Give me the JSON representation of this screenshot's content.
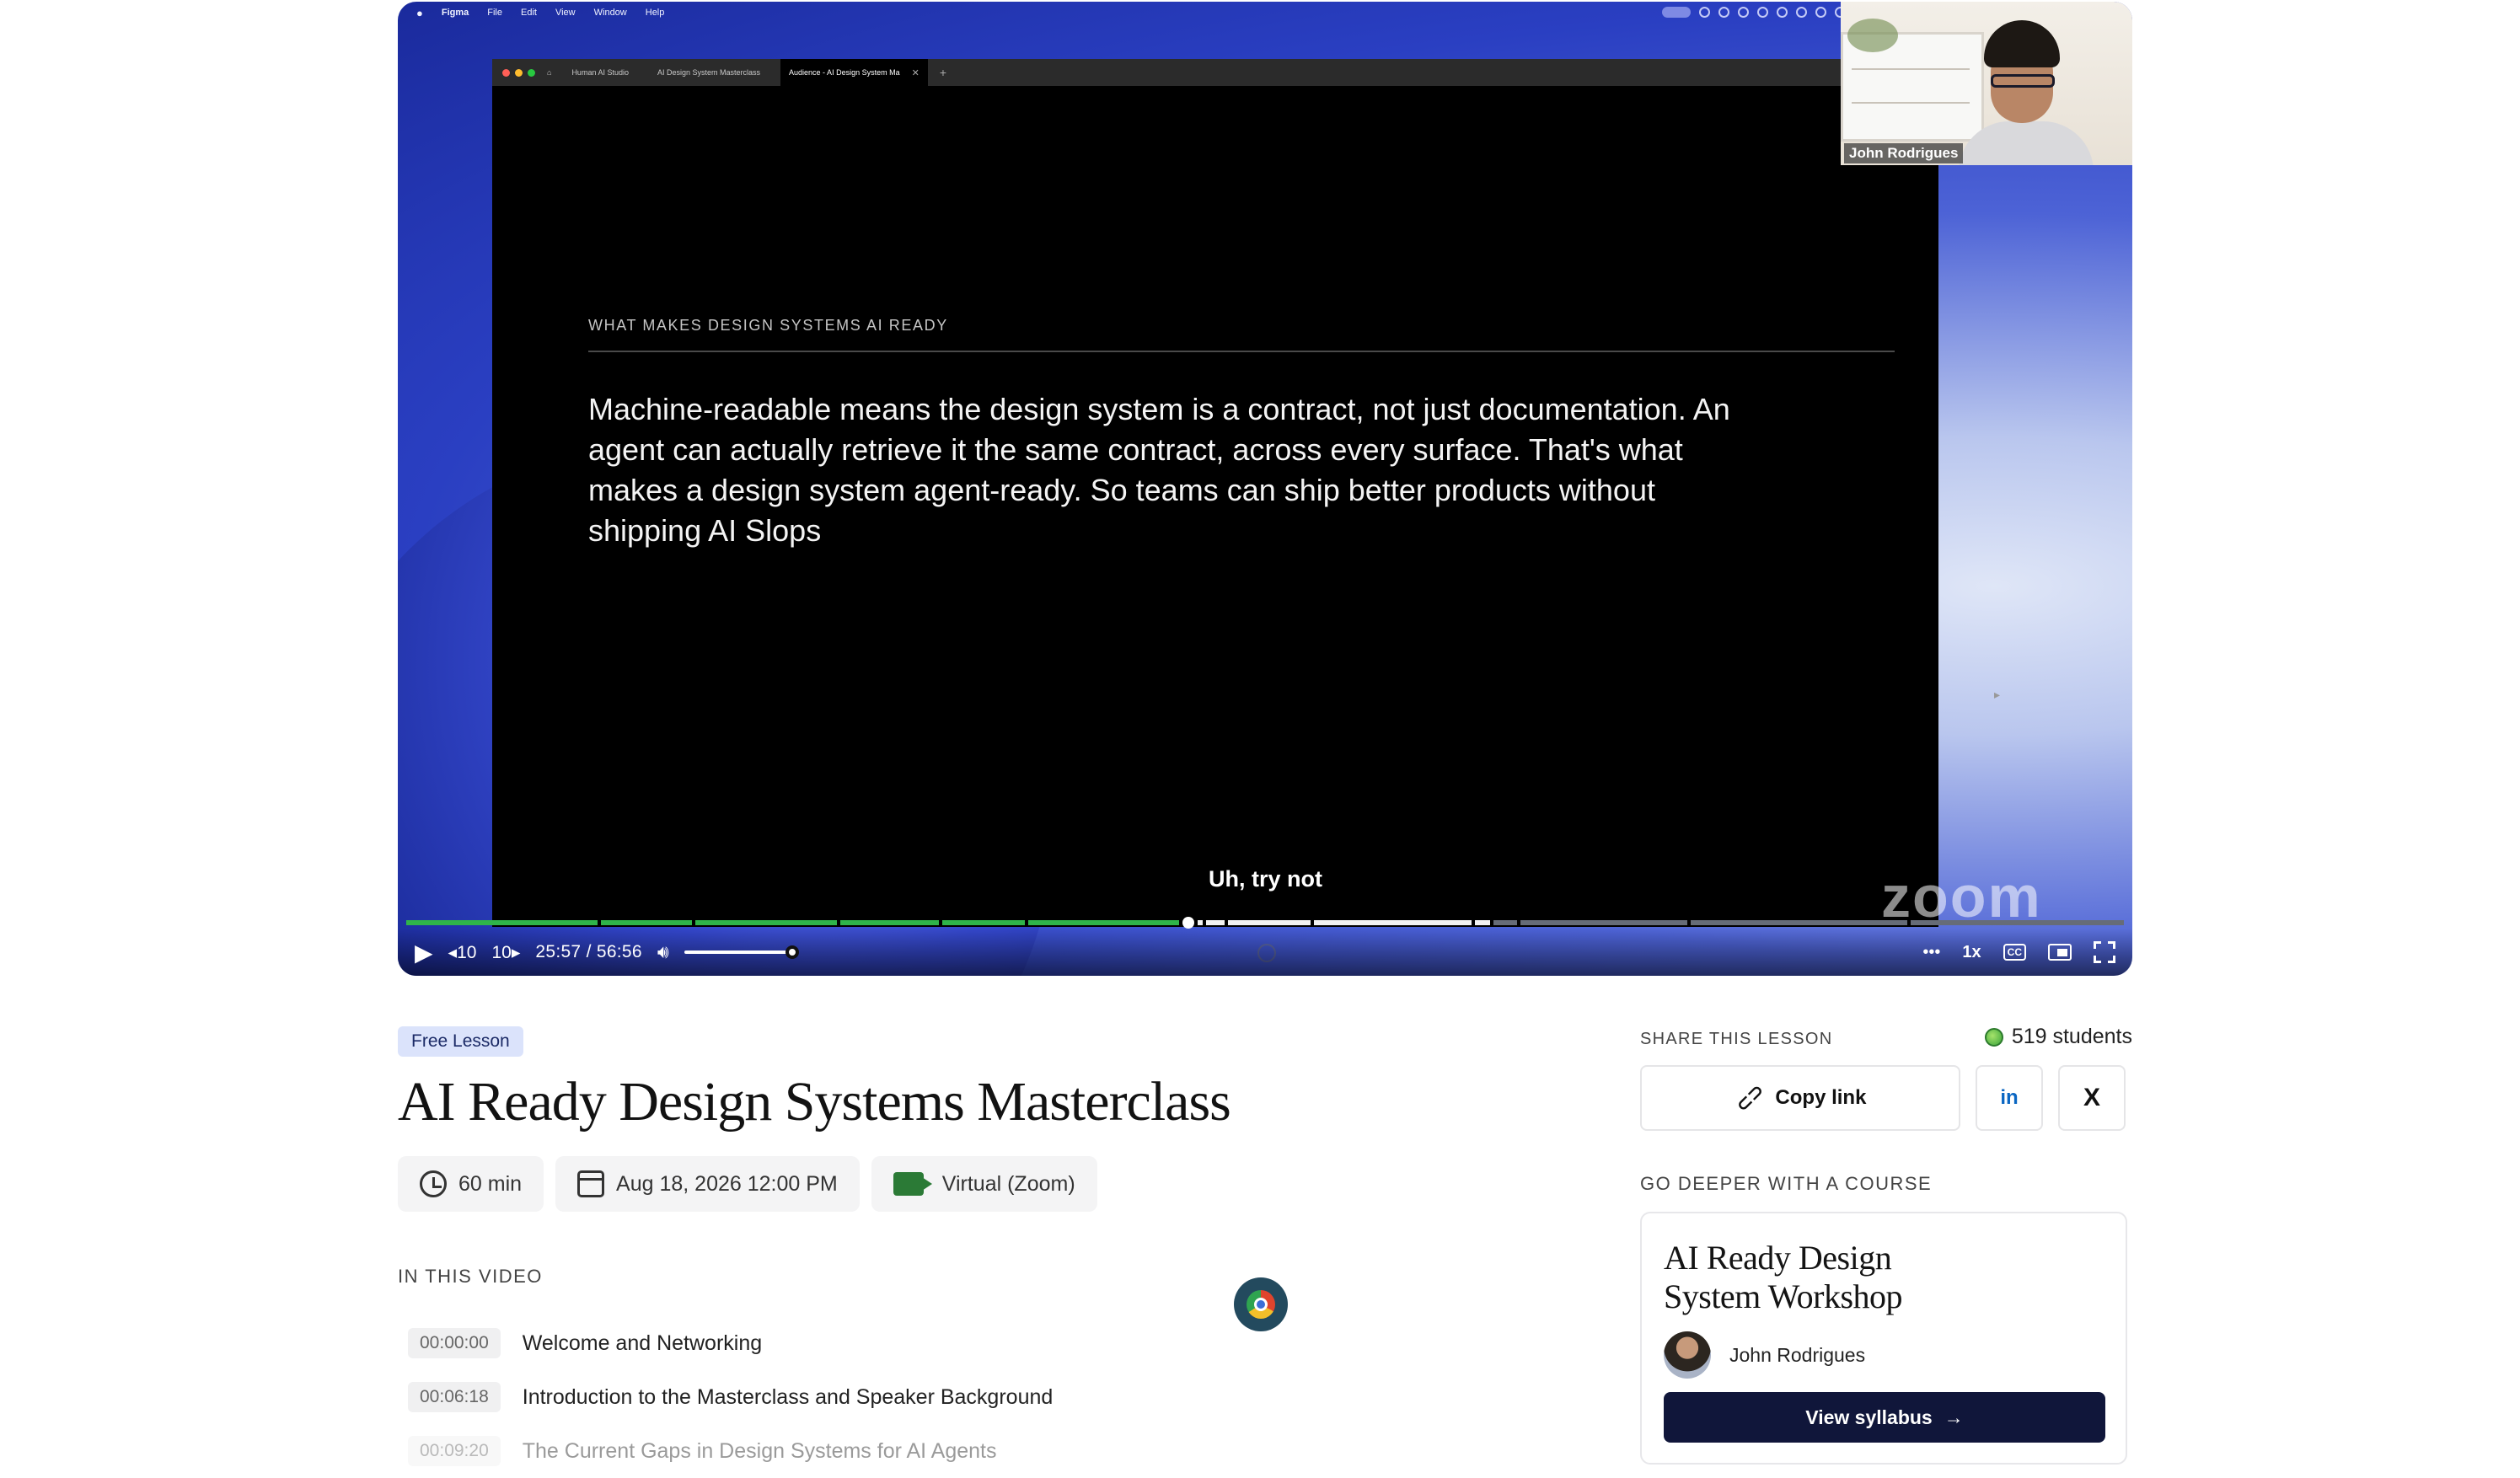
{
  "player": {
    "mac_menu": [
      "Figma",
      "File",
      "Edit",
      "View",
      "Window",
      "Help"
    ],
    "browser_tabs": [
      "Human AI Studio",
      "AI Design System Masterclass",
      "Audience - AI Design System Ma"
    ],
    "slide_kicker": "WHAT MAKES DESIGN SYSTEMS AI READY",
    "slide_body": "Machine-readable means the design system is a contract, not just documentation. An agent can actually retrieve it the same contract, across every surface. That's what makes a design system agent-ready. So teams can ship better products without shipping AI Slops",
    "webcam_name": "John Rodrigues",
    "caption": "Uh, try not",
    "watermark": "zoom",
    "controls": {
      "rewind_label": "10",
      "forward_label": "10",
      "current_time": "25:57",
      "separator": "/",
      "duration": "56:56",
      "speed": "1x",
      "cc_label": "CC",
      "volume_level": 1.0,
      "progress_fraction": 0.456,
      "buffered_fraction": 0.627
    },
    "colors": {
      "progress_played": "#2fb44a",
      "background_blue": "#2a3fc2"
    }
  },
  "lesson": {
    "badge": "Free Lesson",
    "title": "AI Ready Design Systems Masterclass",
    "duration": "60 min",
    "datetime": "Aug 18, 2026 12:00 PM",
    "location": "Virtual (Zoom)",
    "in_this_video_heading": "IN THIS VIDEO",
    "chapters": [
      {
        "time": "00:00:00",
        "title": "Welcome and Networking"
      },
      {
        "time": "00:06:18",
        "title": "Introduction to the Masterclass and Speaker Background"
      },
      {
        "time": "00:09:20",
        "title": "The Current Gaps in Design Systems for AI Agents"
      }
    ]
  },
  "sidebar": {
    "share_heading": "SHARE THIS LESSON",
    "students": "519 students",
    "copy_link": "Copy link",
    "linkedin": "in",
    "x": "X",
    "deeper_heading": "GO DEEPER WITH A COURSE",
    "course": {
      "title": "AI Ready Design System Workshop",
      "instructor": "John Rodrigues",
      "cta": "View syllabus"
    },
    "colors": {
      "cta_bg": "#10163a",
      "linkedin": "#0a66c2"
    }
  }
}
